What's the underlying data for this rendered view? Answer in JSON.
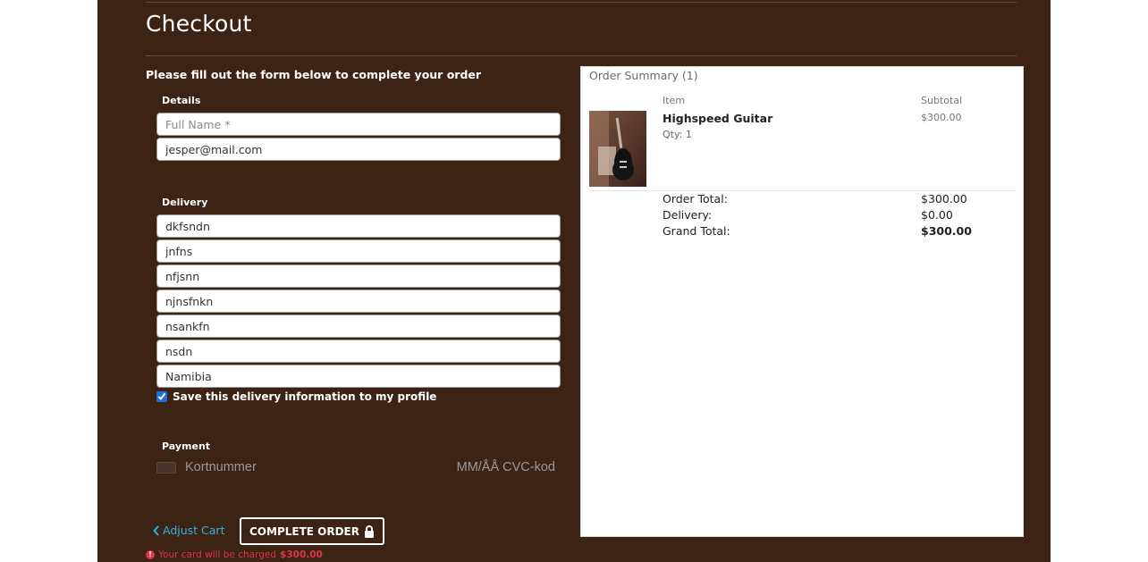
{
  "checkout": {
    "title": "Checkout",
    "intro": "Please fill out the form below to complete your order"
  },
  "details": {
    "legend": "Details",
    "full_name_placeholder": "Full Name *",
    "full_name_value": "",
    "email_value": "jesper@mail.com"
  },
  "delivery": {
    "legend": "Delivery",
    "fields": [
      "dkfsndn",
      "jnfns",
      "nfjsnn",
      "njnsfnkn",
      "nsankfn",
      "nsdn",
      "Namibia"
    ],
    "save_label": "Save this delivery information to my profile",
    "save_checked": true
  },
  "payment": {
    "legend": "Payment",
    "card_placeholder": "Kortnummer",
    "expiry_cvc_placeholder": "MM/ÅÅ CVC-kod"
  },
  "actions": {
    "adjust_cart": "Adjust Cart",
    "complete_order": "COMPLETE ORDER",
    "charge_note": "Your card will be charged",
    "charge_amount": "$300.00"
  },
  "summary": {
    "title": "Order Summary (1)",
    "item_header": "Item",
    "subtotal_header": "Subtotal",
    "items": [
      {
        "name": "Highspeed Guitar",
        "qty": "Qty: 1",
        "subtotal": "$300.00"
      }
    ],
    "order_total_label": "Order Total:",
    "order_total": "$300.00",
    "delivery_label": "Delivery:",
    "delivery": "$0.00",
    "grand_total_label": "Grand Total:",
    "grand_total": "$300.00"
  },
  "colors": {
    "panel_bg": "#3d2314",
    "link": "#2fb6e0",
    "warning": "#e0344a"
  },
  "icons": [
    "chevron-left-icon",
    "lock-icon",
    "alert-circle-icon",
    "credit-card-icon"
  ]
}
